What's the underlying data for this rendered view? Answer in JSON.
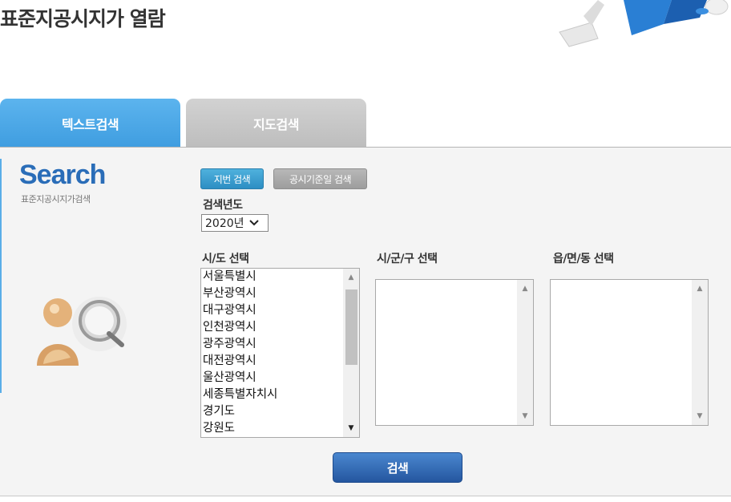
{
  "header": {
    "title": "표준지공시지가 열람"
  },
  "tabs": [
    {
      "label": "텍스트검색",
      "active": true
    },
    {
      "label": "지도검색",
      "active": false
    }
  ],
  "sidebar": {
    "logo": "Search",
    "subtitle": "표준지공시지가검색"
  },
  "search_mode": {
    "lot_button": "지번 검색",
    "date_button": "공시기준일 검색"
  },
  "year": {
    "label": "검색년도",
    "selected": "2020년"
  },
  "sido": {
    "label": "시/도 선택",
    "options": [
      "서울특별시",
      "부산광역시",
      "대구광역시",
      "인천광역시",
      "광주광역시",
      "대전광역시",
      "울산광역시",
      "세종특별자치시",
      "경기도",
      "강원도"
    ]
  },
  "sigungu": {
    "label": "시/군/구 선택",
    "options": []
  },
  "eupmyeondong": {
    "label": "읍/면/동 선택",
    "options": []
  },
  "actions": {
    "search_button": "검색"
  },
  "colors": {
    "accent": "#3f9de0",
    "tab_inactive": "#bdbdbd",
    "search_button": "#24569f"
  }
}
